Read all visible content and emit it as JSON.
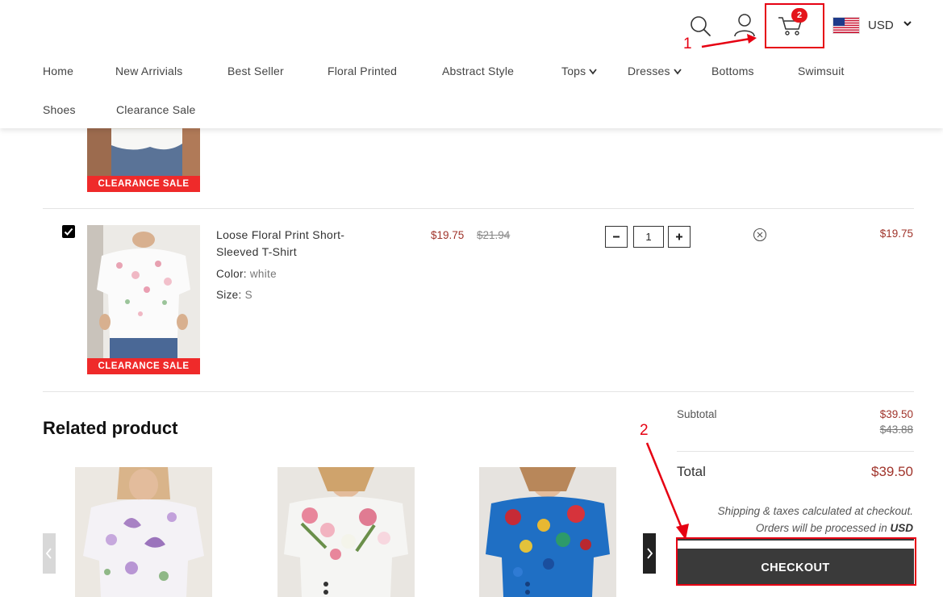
{
  "header": {
    "cart_count": "2",
    "currency": "USD",
    "nav": [
      "Home",
      "New Arrivials",
      "Best Seller",
      "Floral Printed",
      "Abstract Style",
      "Tops",
      "Dresses",
      "Bottoms",
      "Swimsuit",
      "Shoes",
      "Clearance Sale"
    ]
  },
  "cart": {
    "items": [
      {
        "sale_tag": "CLEARANCE SALE"
      },
      {
        "name": "Loose Floral Print Short-Sleeved T-Shirt",
        "color_label": "Color:",
        "color_value": "white",
        "size_label": "Size:",
        "size_value": "S",
        "price": "$19.75",
        "original_price": "$21.94",
        "quantity": "1",
        "line_total": "$19.75",
        "sale_tag": "CLEARANCE SALE",
        "checked": true
      }
    ]
  },
  "related": {
    "title": "Related product"
  },
  "summary": {
    "subtotal_label": "Subtotal",
    "subtotal": "$39.50",
    "subtotal_original": "$43.88",
    "total_label": "Total",
    "total": "$39.50",
    "shipping_note": "Shipping & taxes calculated at checkout.",
    "currency_note_prefix": "Orders will be processed in",
    "currency_note_value": "USD",
    "checkout_label": "CHECKOUT"
  },
  "annotations": {
    "step1": "1",
    "step2": "2"
  },
  "colors": {
    "price": "#a0342b",
    "sale_tag": "#ef2a2a",
    "annotation": "#e60012",
    "checkout": "#3a3a3a"
  }
}
